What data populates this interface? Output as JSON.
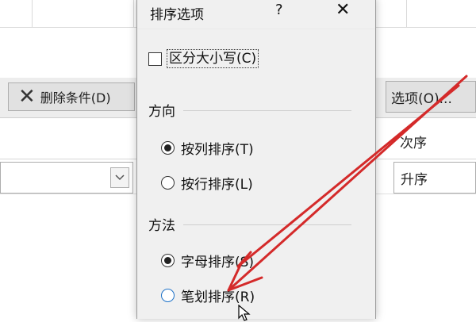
{
  "background_dialog": {
    "delete_condition_label": "删除条件(D)",
    "options_button_label": "选项(O)...",
    "order_header": "次序",
    "order_value": "升序"
  },
  "options_dialog": {
    "title": "排序选项",
    "help_label": "?",
    "close_label": "✕",
    "case_sensitive": {
      "label": "区分大小写(C)",
      "checked": false
    },
    "direction": {
      "title": "方向",
      "options": [
        {
          "label": "按列排序(T)",
          "selected": true
        },
        {
          "label": "按行排序(L)",
          "selected": false
        }
      ]
    },
    "method": {
      "title": "方法",
      "options": [
        {
          "label": "字母排序(S)",
          "selected": true
        },
        {
          "label": "笔划排序(R)",
          "selected": false
        }
      ]
    }
  },
  "annotation": {
    "arrow_color": "#d42a2a",
    "icons": [
      "close-icon",
      "delete-x-icon",
      "chevron-down-icon",
      "mouse-cursor-icon"
    ]
  }
}
